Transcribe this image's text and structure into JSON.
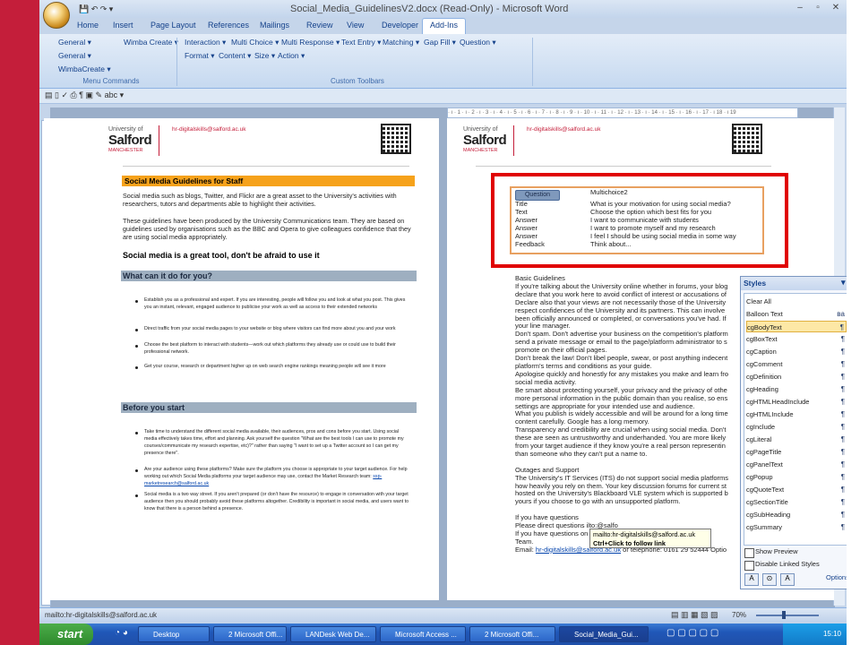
{
  "window": {
    "title": "Social_Media_GuidelinesV2.docx (Read-Only) - Microsoft Word",
    "min": "–",
    "max": "▫",
    "close": "✕"
  },
  "tabs": [
    "Home",
    "Insert",
    "Page Layout",
    "References",
    "Mailings",
    "Review",
    "View",
    "Developer",
    "Add-Ins"
  ],
  "ribbon": {
    "menu_commands": {
      "items": [
        "General ▾",
        "General ▾",
        "WimbaCreate ▾",
        "Wimba Create ▾"
      ],
      "label": "Menu Commands"
    },
    "custom_toolbars": {
      "row1": [
        "Interaction ▾",
        "Multi Choice ▾",
        "Multi Response ▾",
        "Text Entry ▾",
        "Matching ▾",
        "Gap Fill ▾",
        "Question ▾"
      ],
      "row2": [
        "Format ▾",
        "Content ▾",
        "Size ▾",
        "Action ▾"
      ],
      "label": "Custom Toolbars"
    }
  },
  "ruler_text": "· ı · 1 · ı · 2 · ı · 3 · ı · 4 · ı · 5 · ı · 6 · ı · 7 · ı · 8 · ı · 9 · ı · 10 · ı · 11 · ı · 12 · ı · 13 · ı · 14 · ı · 15 · ı · 16 · ı · 17 · ı 18 · ı 19",
  "page1": {
    "logo_small": "University of",
    "logo_big": "Salford",
    "logo_man": "MANCHESTER",
    "email": "hr-digitalskills@salford.ac.uk",
    "title": "Social Media Guidelines for Staff",
    "intro1": "Social media such as blogs, Twitter, and Flickr are a great asset to the University's activities with researchers, tutors and departments able to highlight their activities.",
    "intro2": "These guidelines have been produced by the University Communications team. They are based on guidelines used by organisations such as the BBC and Opera to give colleagues confidence that they are using social media appropriately.",
    "tagline": "Social media is a great tool, don't be afraid to use it",
    "sec1": "What can it do for you?",
    "sec1_bullets": [
      "Establish you as a professional and expert. If you are interesting, people will follow you and look at what you post. This gives you an instant, relevant, engaged audience to publicise your work as well as access to their extended networks",
      "Direct traffic from your social media pages to your website or blog where visitors can find more about you and your work",
      "Choose the best platform to interact with students—work out which platforms they already use or could use to build their professional network.",
      "Get your course, research or department higher up on web search engine rankings meaning people will see it more"
    ],
    "sec2": "Before you start",
    "sec2_bullets": [
      "Take time to understand the different social media available, their audiences, pros and cons before you start. Using social media effectively takes time, effort and planning. Ask yourself the question \"What are the best tools I can use to promote my courses/communicate my research expertise, etc)?\" rather than saying \"I want to set up a Twitter account so I can get my presence there\".",
      "Are your audience using these platforms? Make sure the platform you choose is appropriate to your target audience. For help working out which Social Media platforms your target audience may use, contact the Market Research team: ",
      "Social media is a two way street. If you aren't prepared (or don't have the resource) to engage in conversation with your target audience then you should probably avoid these platforms altogether. Credibility is important in social media, and users want to know that there is a person behind a presence."
    ],
    "market_email": "ssp-marketresearch@salford.ac.uk"
  },
  "page2": {
    "logo_small": "University of",
    "logo_big": "Salford",
    "logo_man": "MANCHESTER",
    "email": "hr-digitalskills@salford.ac.uk",
    "question_btn": "Question",
    "mc_header": "Multichoice2",
    "mc_rows": [
      {
        "k": "Title",
        "v": "What is your motivation for using social media?"
      },
      {
        "k": "Text",
        "v": "Choose the option which best fits for you"
      },
      {
        "k": "Answer",
        "v": "I want to communicate with students"
      },
      {
        "k": "Answer",
        "v": "I want to promote myself and my research"
      },
      {
        "k": "Answer",
        "v": "I feel I should be using social media in some way"
      },
      {
        "k": "Feedback",
        "v": "Think about..."
      }
    ],
    "body_lines": [
      "Basic Guidelines",
      "If you're talking about the University online whether in forums, your blog",
      "declare that you work here to avoid conflict of interest or accusations of",
      "Declare also that your views are not necessarily those of the University",
      "respect confidences of the University and its partners. This can involve",
      "been officially announced or completed, or conversations you've had. If",
      "your line manager.",
      "Don't spam. Don't advertise your business on the competition's platform",
      "send a private message or email to the page/platform administrator to s",
      "promote on their official pages.",
      "Don't break the law! Don't libel people, swear, or post anything indecent",
      "platform's terms and conditions as your guide.",
      "Apologise quickly and honestly for any mistakes you make and learn fro",
      "social media activity.",
      "Be smart about protecting yourself, your privacy and the privacy of othe",
      "more personal information in the public domain than you realise, so ens",
      "settings are appropriate for your intended use and audience.",
      "What you publish is widely accessible and will be around for a long time",
      "content carefully. Google has a long memory.",
      "Transparency and credibility are crucial when using social media. Don't",
      "these are seen as untrustworthy and underhanded. You are more likely",
      "from your target audience if they know you're a real person representin",
      "than someone who they can't put a name to.",
      "",
      "Outages and Support",
      "The University's IT Services (ITS) do not support social media platforms",
      "how heavily you rely on them. Your key discussion forums for current st",
      "hosted on the University's Blackboard VLE system which is supported b",
      "yours if you choose to go with an unsupported platform.",
      "",
      "If you have questions",
      "Please direct questions                                          ilto:@salfo",
      "If you have questions on                                       edia, con",
      "Team."
    ],
    "email_line_prefix": "Email: ",
    "email_line_link": "hr-digitalskills@salford.ac.uk",
    "email_line_suffix": " or telephone: 0161 29 52444  Optio"
  },
  "tooltip": {
    "line1": "mailto:hr-digitalskills@salford.ac.uk",
    "line2": "Ctrl+Click to follow link"
  },
  "styles_pane": {
    "title": "Styles",
    "items": [
      "Clear All",
      "Balloon Text",
      "cgBodyText",
      "cgBoxText",
      "cgCaption",
      "cgComment",
      "cgDefinition",
      "cgHeading",
      "cgHTMLHeadInclude",
      "cgHTMLInclude",
      "cgInclude",
      "cgLiteral",
      "cgPageTitle",
      "cgPanelText",
      "cgPopup",
      "cgQuoteText",
      "cgSectionTitle",
      "cgSubHeading",
      "cgSummary"
    ],
    "selected": "cgBodyText",
    "show_preview": "Show Preview",
    "disable_linked": "Disable Linked Styles",
    "options": "Options..."
  },
  "statusbar": {
    "left": "mailto:hr-digitalskills@salford.ac.uk",
    "zoom": "70%"
  },
  "taskbar": {
    "start": "start",
    "items": [
      "Desktop",
      "2 Microsoft Offi...",
      "LANDesk Web De...",
      "Microsoft Access ...",
      "2 Microsoft Offi...",
      "Social_Media_Gui..."
    ],
    "time": "15:10"
  }
}
